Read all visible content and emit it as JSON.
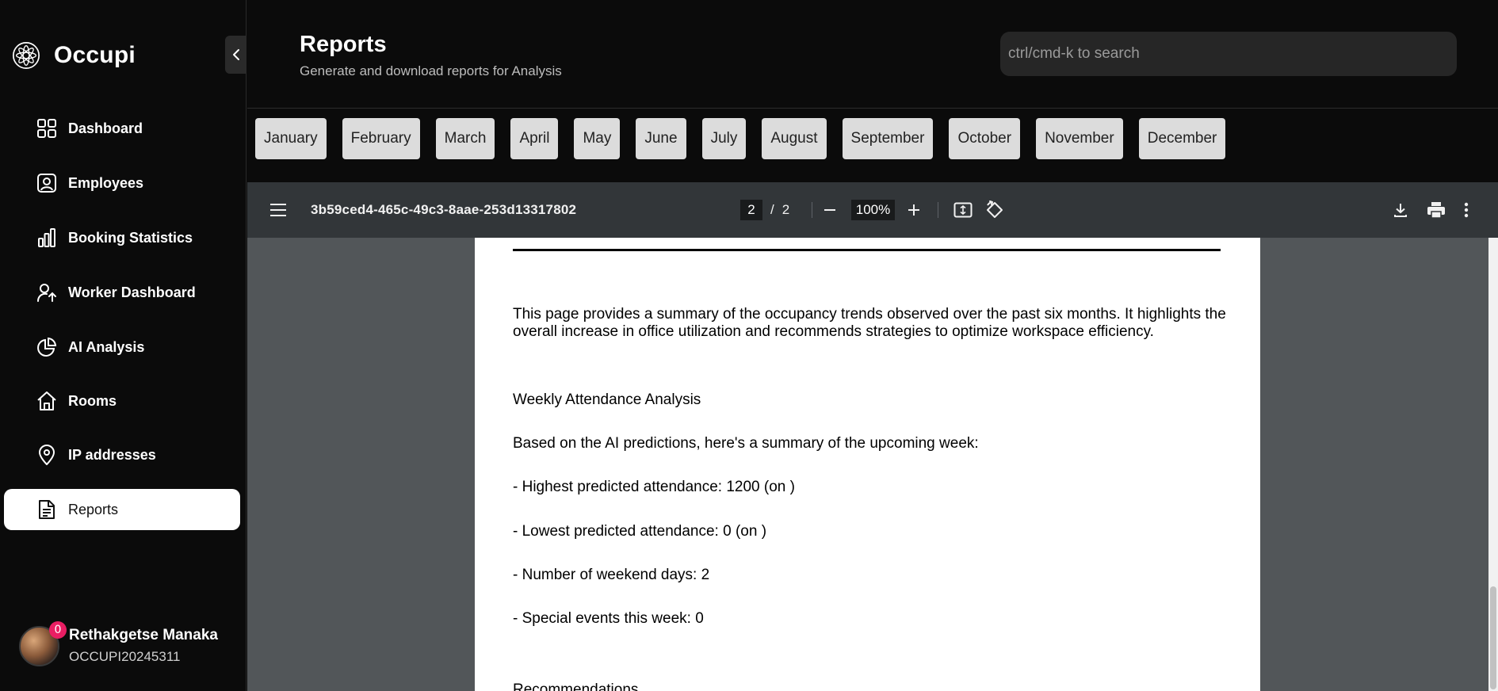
{
  "app": {
    "name": "Occupi"
  },
  "sidebar": {
    "items": [
      {
        "label": "Dashboard",
        "icon": "grid-icon"
      },
      {
        "label": "Employees",
        "icon": "user-square-icon"
      },
      {
        "label": "Booking Statistics",
        "icon": "bar-chart-icon"
      },
      {
        "label": "Worker Dashboard",
        "icon": "user-arrow-icon"
      },
      {
        "label": "AI Analysis",
        "icon": "pie-chart-icon"
      },
      {
        "label": "Rooms",
        "icon": "home-icon"
      },
      {
        "label": "IP addresses",
        "icon": "map-pin-icon"
      },
      {
        "label": "Reports",
        "icon": "file-text-icon"
      }
    ],
    "active": "Reports"
  },
  "user": {
    "name": "Rethakgetse Manaka",
    "id": "OCCUPI20245311",
    "notifications": "0"
  },
  "header": {
    "title": "Reports",
    "subtitle": "Generate and download reports for Analysis",
    "search_placeholder": "ctrl/cmd-k to search"
  },
  "months": [
    "January",
    "February",
    "March",
    "April",
    "May",
    "June",
    "July",
    "August",
    "September",
    "October",
    "November",
    "December"
  ],
  "viewer": {
    "document_name": "3b59ced4-465c-49c3-8aae-253d13317802",
    "current_page": "2",
    "page_separator": "/",
    "total_pages": "2",
    "zoom": "100%"
  },
  "pdf": {
    "intro": "This page provides a summary of the occupancy trends observed over the past six months. It highlights the overall increase in office utilization and recommends strategies to optimize workspace efficiency.",
    "section_title": "Weekly Attendance Analysis",
    "summary_intro": "Based on the AI predictions, here's a summary of the upcoming week:",
    "bullets": [
      "- Highest predicted attendance: 1200 (on )",
      "- Lowest predicted attendance: 0 (on )",
      "- Number of weekend days: 2",
      "- Special events this week: 0"
    ],
    "next_heading": "Recommendations"
  },
  "colors": {
    "background": "#0b0b0b",
    "sidebar_active_bg": "#ffffff",
    "month_button_bg": "#dcdcdc",
    "viewer_bg": "#525659",
    "toolbar_bg": "#323639",
    "badge": "#e91e63"
  }
}
